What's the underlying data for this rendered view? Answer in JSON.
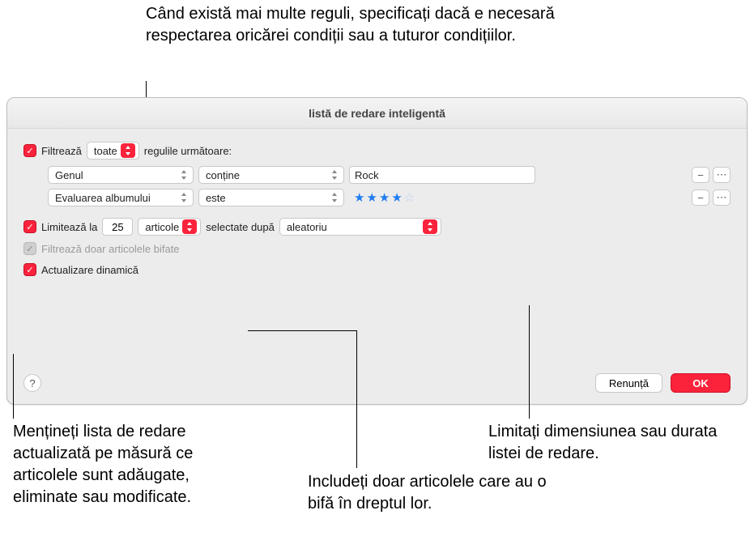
{
  "callouts": {
    "top": "Când există mai multe reguli, specificați dacă e necesară respectarea oricărei condiții sau a tuturor condițiilor.",
    "bottom_left": "Mențineți lista de redare actualizată pe măsură ce articolele sunt adăugate, eliminate sau modificate.",
    "bottom_mid": "Includeți doar articolele care au o bifă în dreptul lor.",
    "bottom_right": "Limitați dimensiunea sau durata listei de redare."
  },
  "dialog": {
    "title": "listă de redare inteligentă",
    "filter": {
      "prefix": "Filtrează",
      "mode": "toate",
      "suffix": "regulile următoare:"
    },
    "rules": [
      {
        "field": "Genul",
        "op": "conține",
        "value": "Rock",
        "type": "text"
      },
      {
        "field": "Evaluarea albumului",
        "op": "este",
        "value": "★★★★☆",
        "type": "stars"
      }
    ],
    "limit": {
      "label": "Limitează la",
      "count": "25",
      "unit": "articole",
      "selected_label": "selectate după",
      "method": "aleatoriu"
    },
    "only_checked": "Filtrează doar articolele bifate",
    "live_update": "Actualizare dinamică",
    "buttons": {
      "cancel": "Renunță",
      "ok": "OK",
      "help": "?"
    }
  }
}
